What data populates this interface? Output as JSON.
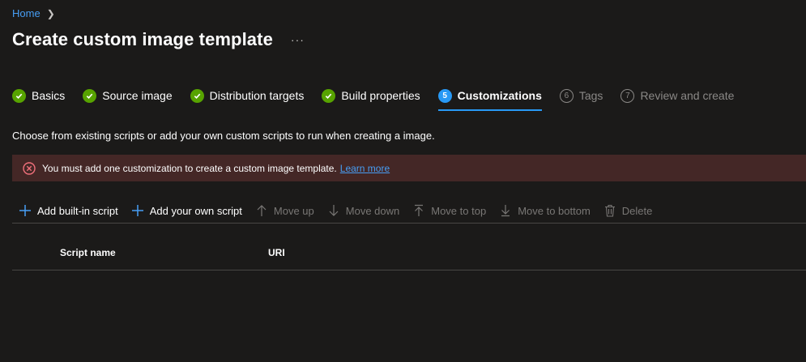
{
  "breadcrumb": {
    "home": "Home"
  },
  "header": {
    "title": "Create custom image template",
    "more": "···"
  },
  "steps": [
    {
      "label": "Basics",
      "state": "done"
    },
    {
      "label": "Source image",
      "state": "done"
    },
    {
      "label": "Distribution targets",
      "state": "done"
    },
    {
      "label": "Build properties",
      "state": "done"
    },
    {
      "label": "Customizations",
      "state": "active",
      "number": "5"
    },
    {
      "label": "Tags",
      "state": "pending",
      "number": "6"
    },
    {
      "label": "Review and create",
      "state": "pending",
      "number": "7"
    }
  ],
  "description": "Choose from existing scripts or add your own custom scripts to run when creating a image.",
  "error": {
    "message": "You must add one customization to create a custom image template.",
    "link": "Learn more"
  },
  "toolbar": {
    "add_builtin": "Add built-in script",
    "add_own": "Add your own script",
    "move_up": "Move up",
    "move_down": "Move down",
    "move_top": "Move to top",
    "move_bottom": "Move to bottom",
    "delete": "Delete"
  },
  "table": {
    "columns": [
      "Script name",
      "URI"
    ]
  },
  "colors": {
    "accent": "#2899f5",
    "success": "#57a300",
    "error_bg": "#442726",
    "link": "#479ef5"
  }
}
